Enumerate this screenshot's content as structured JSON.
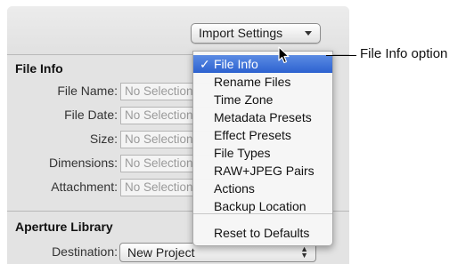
{
  "import_button": {
    "label": "Import Settings"
  },
  "file_info": {
    "title": "File Info",
    "fields": [
      {
        "label": "File Name:",
        "value": "No Selection"
      },
      {
        "label": "File Date:",
        "value": "No Selection"
      },
      {
        "label": "Size:",
        "value": "No Selection"
      },
      {
        "label": "Dimensions:",
        "value": "No Selection"
      },
      {
        "label": "Attachment:",
        "value": "No Selection"
      }
    ]
  },
  "aperture_library": {
    "title": "Aperture Library",
    "destination_label": "Destination:",
    "destination_value": "New Project"
  },
  "menu": {
    "check_mark": "✓",
    "items": [
      {
        "label": "File Info",
        "selected": true
      },
      {
        "label": "Rename Files"
      },
      {
        "label": "Time Zone"
      },
      {
        "label": "Metadata Presets"
      },
      {
        "label": "Effect Presets"
      },
      {
        "label": "File Types"
      },
      {
        "label": "RAW+JPEG Pairs"
      },
      {
        "label": "Actions"
      },
      {
        "label": "Backup Location"
      }
    ],
    "reset_label": "Reset to Defaults"
  },
  "callout": {
    "text": "File Info option"
  },
  "icons": {
    "cursor": "arrow-cursor-icon",
    "dropdown": "chevron-down-icon",
    "stepper": "up-down-arrows-icon"
  },
  "colors": {
    "selection": "#3a6fd8",
    "panel": "#e3e3e3"
  }
}
